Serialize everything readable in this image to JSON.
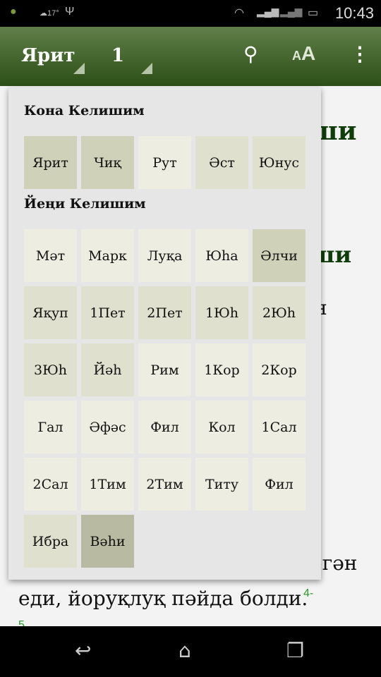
{
  "status": {
    "time": "10:43",
    "weather": "17°"
  },
  "appbar": {
    "book": "Ярит",
    "chapter": "1"
  },
  "background": {
    "heading1": "ши",
    "heading2": "ши",
    "line1": "н",
    "line2": "егән",
    "line3": "еди, йоруқлуқ пәйда болди.",
    "verse": "4-",
    "verse_next": "5"
  },
  "popup": {
    "old_title": "Кона Келишим",
    "new_title": "Йеңи Келишим",
    "old": [
      {
        "label": "Ярит",
        "shade": 2
      },
      {
        "label": "Чиқ",
        "shade": 2
      },
      {
        "label": "Рут",
        "shade": 0
      },
      {
        "label": "Әст",
        "shade": 1
      },
      {
        "label": "Юнус",
        "shade": 1
      }
    ],
    "new": [
      {
        "label": "Мәт",
        "shade": 0
      },
      {
        "label": "Марк",
        "shade": 0
      },
      {
        "label": "Луқа",
        "shade": 0
      },
      {
        "label": "Юһа",
        "shade": 0
      },
      {
        "label": "Әлчи",
        "shade": 2
      },
      {
        "label": "Яқуп",
        "shade": 1
      },
      {
        "label": "1Пет",
        "shade": 1
      },
      {
        "label": "2Пет",
        "shade": 1
      },
      {
        "label": "1Юһ",
        "shade": 1
      },
      {
        "label": "2Юһ",
        "shade": 1
      },
      {
        "label": "3Юһ",
        "shade": 1
      },
      {
        "label": "Йәһ",
        "shade": 1
      },
      {
        "label": "Рим",
        "shade": 0
      },
      {
        "label": "1Кор",
        "shade": 0
      },
      {
        "label": "2Кор",
        "shade": 0
      },
      {
        "label": "Гал",
        "shade": 0
      },
      {
        "label": "Әфәс",
        "shade": 0
      },
      {
        "label": "Фил",
        "shade": 0
      },
      {
        "label": "Кол",
        "shade": 0
      },
      {
        "label": "1Сал",
        "shade": 0
      },
      {
        "label": "2Сал",
        "shade": 0
      },
      {
        "label": "1Тим",
        "shade": 0
      },
      {
        "label": "2Тим",
        "shade": 0
      },
      {
        "label": "Титу",
        "shade": 0
      },
      {
        "label": "Фил",
        "shade": 0
      },
      {
        "label": "Ибра",
        "shade": 1
      },
      {
        "label": "Вәһи",
        "shade": 3
      }
    ]
  }
}
